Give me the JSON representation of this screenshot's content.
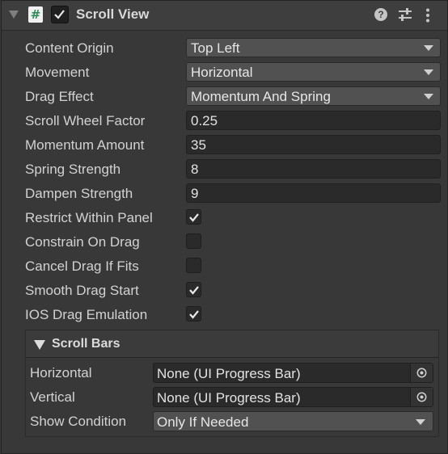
{
  "component": {
    "title": "Scroll View",
    "enabled": true,
    "script_icon": "#"
  },
  "fields": {
    "content_origin": {
      "label": "Content Origin",
      "value": "Top Left"
    },
    "movement": {
      "label": "Movement",
      "value": "Horizontal"
    },
    "drag_effect": {
      "label": "Drag Effect",
      "value": "Momentum And Spring"
    },
    "scroll_wheel_factor": {
      "label": "Scroll Wheel Factor",
      "value": "0.25"
    },
    "momentum_amount": {
      "label": "Momentum Amount",
      "value": "35"
    },
    "spring_strength": {
      "label": "Spring Strength",
      "value": "8"
    },
    "dampen_strength": {
      "label": "Dampen Strength",
      "value": "9"
    },
    "restrict_within_panel": {
      "label": "Restrict Within Panel",
      "checked": true
    },
    "constrain_on_drag": {
      "label": "Constrain On Drag",
      "checked": false
    },
    "cancel_drag_if_fits": {
      "label": "Cancel Drag If Fits",
      "checked": false
    },
    "smooth_drag_start": {
      "label": "Smooth Drag Start",
      "checked": true
    },
    "ios_drag_emulation": {
      "label": "IOS Drag Emulation",
      "checked": true
    }
  },
  "scroll_bars": {
    "title": "Scroll Bars",
    "horizontal": {
      "label": "Horizontal",
      "value": "None (UI Progress Bar)"
    },
    "vertical": {
      "label": "Vertical",
      "value": "None (UI Progress Bar)"
    },
    "show_condition": {
      "label": "Show Condition",
      "value": "Only If Needed"
    }
  },
  "icons": {
    "help": "?",
    "fold": "triangle-down",
    "preset": "sliders",
    "menu": "kebab"
  }
}
